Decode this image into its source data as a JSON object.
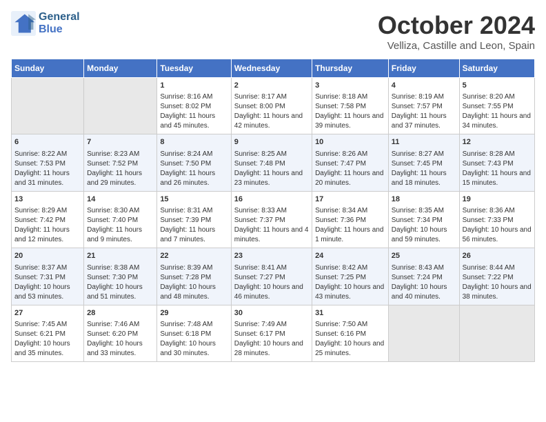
{
  "header": {
    "logo_line1": "General",
    "logo_line2": "Blue",
    "month": "October 2024",
    "location": "Velliza, Castille and Leon, Spain"
  },
  "weekdays": [
    "Sunday",
    "Monday",
    "Tuesday",
    "Wednesday",
    "Thursday",
    "Friday",
    "Saturday"
  ],
  "weeks": [
    [
      {
        "date": "",
        "info": ""
      },
      {
        "date": "",
        "info": ""
      },
      {
        "date": "1",
        "info": "Sunrise: 8:16 AM\nSunset: 8:02 PM\nDaylight: 11 hours and 45 minutes."
      },
      {
        "date": "2",
        "info": "Sunrise: 8:17 AM\nSunset: 8:00 PM\nDaylight: 11 hours and 42 minutes."
      },
      {
        "date": "3",
        "info": "Sunrise: 8:18 AM\nSunset: 7:58 PM\nDaylight: 11 hours and 39 minutes."
      },
      {
        "date": "4",
        "info": "Sunrise: 8:19 AM\nSunset: 7:57 PM\nDaylight: 11 hours and 37 minutes."
      },
      {
        "date": "5",
        "info": "Sunrise: 8:20 AM\nSunset: 7:55 PM\nDaylight: 11 hours and 34 minutes."
      }
    ],
    [
      {
        "date": "6",
        "info": "Sunrise: 8:22 AM\nSunset: 7:53 PM\nDaylight: 11 hours and 31 minutes."
      },
      {
        "date": "7",
        "info": "Sunrise: 8:23 AM\nSunset: 7:52 PM\nDaylight: 11 hours and 29 minutes."
      },
      {
        "date": "8",
        "info": "Sunrise: 8:24 AM\nSunset: 7:50 PM\nDaylight: 11 hours and 26 minutes."
      },
      {
        "date": "9",
        "info": "Sunrise: 8:25 AM\nSunset: 7:48 PM\nDaylight: 11 hours and 23 minutes."
      },
      {
        "date": "10",
        "info": "Sunrise: 8:26 AM\nSunset: 7:47 PM\nDaylight: 11 hours and 20 minutes."
      },
      {
        "date": "11",
        "info": "Sunrise: 8:27 AM\nSunset: 7:45 PM\nDaylight: 11 hours and 18 minutes."
      },
      {
        "date": "12",
        "info": "Sunrise: 8:28 AM\nSunset: 7:43 PM\nDaylight: 11 hours and 15 minutes."
      }
    ],
    [
      {
        "date": "13",
        "info": "Sunrise: 8:29 AM\nSunset: 7:42 PM\nDaylight: 11 hours and 12 minutes."
      },
      {
        "date": "14",
        "info": "Sunrise: 8:30 AM\nSunset: 7:40 PM\nDaylight: 11 hours and 9 minutes."
      },
      {
        "date": "15",
        "info": "Sunrise: 8:31 AM\nSunset: 7:39 PM\nDaylight: 11 hours and 7 minutes."
      },
      {
        "date": "16",
        "info": "Sunrise: 8:33 AM\nSunset: 7:37 PM\nDaylight: 11 hours and 4 minutes."
      },
      {
        "date": "17",
        "info": "Sunrise: 8:34 AM\nSunset: 7:36 PM\nDaylight: 11 hours and 1 minute."
      },
      {
        "date": "18",
        "info": "Sunrise: 8:35 AM\nSunset: 7:34 PM\nDaylight: 10 hours and 59 minutes."
      },
      {
        "date": "19",
        "info": "Sunrise: 8:36 AM\nSunset: 7:33 PM\nDaylight: 10 hours and 56 minutes."
      }
    ],
    [
      {
        "date": "20",
        "info": "Sunrise: 8:37 AM\nSunset: 7:31 PM\nDaylight: 10 hours and 53 minutes."
      },
      {
        "date": "21",
        "info": "Sunrise: 8:38 AM\nSunset: 7:30 PM\nDaylight: 10 hours and 51 minutes."
      },
      {
        "date": "22",
        "info": "Sunrise: 8:39 AM\nSunset: 7:28 PM\nDaylight: 10 hours and 48 minutes."
      },
      {
        "date": "23",
        "info": "Sunrise: 8:41 AM\nSunset: 7:27 PM\nDaylight: 10 hours and 46 minutes."
      },
      {
        "date": "24",
        "info": "Sunrise: 8:42 AM\nSunset: 7:25 PM\nDaylight: 10 hours and 43 minutes."
      },
      {
        "date": "25",
        "info": "Sunrise: 8:43 AM\nSunset: 7:24 PM\nDaylight: 10 hours and 40 minutes."
      },
      {
        "date": "26",
        "info": "Sunrise: 8:44 AM\nSunset: 7:22 PM\nDaylight: 10 hours and 38 minutes."
      }
    ],
    [
      {
        "date": "27",
        "info": "Sunrise: 7:45 AM\nSunset: 6:21 PM\nDaylight: 10 hours and 35 minutes."
      },
      {
        "date": "28",
        "info": "Sunrise: 7:46 AM\nSunset: 6:20 PM\nDaylight: 10 hours and 33 minutes."
      },
      {
        "date": "29",
        "info": "Sunrise: 7:48 AM\nSunset: 6:18 PM\nDaylight: 10 hours and 30 minutes."
      },
      {
        "date": "30",
        "info": "Sunrise: 7:49 AM\nSunset: 6:17 PM\nDaylight: 10 hours and 28 minutes."
      },
      {
        "date": "31",
        "info": "Sunrise: 7:50 AM\nSunset: 6:16 PM\nDaylight: 10 hours and 25 minutes."
      },
      {
        "date": "",
        "info": ""
      },
      {
        "date": "",
        "info": ""
      }
    ]
  ]
}
